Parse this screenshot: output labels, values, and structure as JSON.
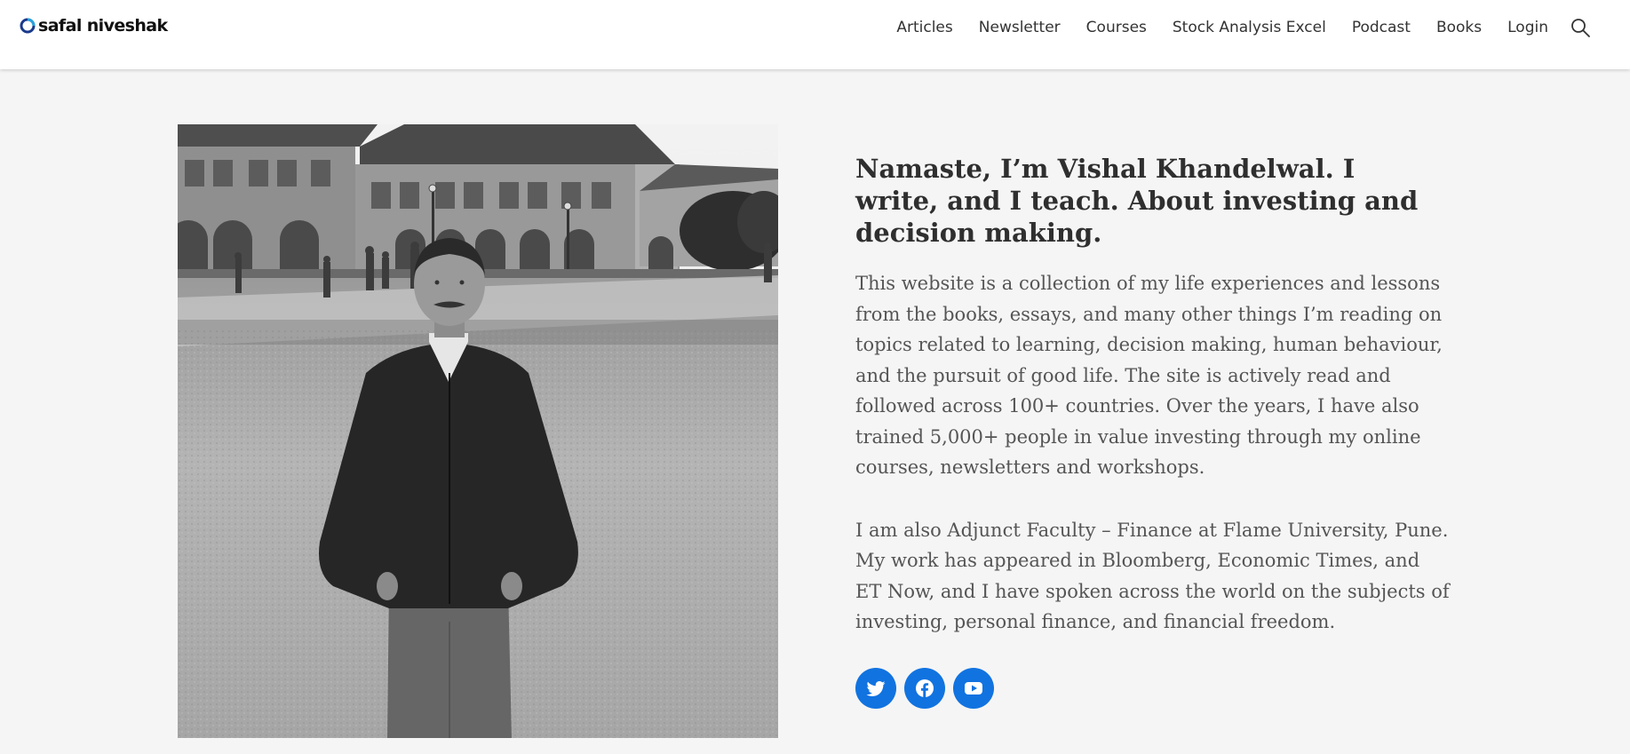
{
  "header": {
    "logo_text": "safal niveshak",
    "nav": [
      "Articles",
      "Newsletter",
      "Courses",
      "Stock Analysis Excel",
      "Podcast",
      "Books",
      "Login"
    ],
    "search_icon": "search-icon"
  },
  "hero": {
    "photo_icon": "portrait-photo",
    "headline": "Namaste, I’m Vishal Khandelwal. I write, and I teach. About investing and decision making.",
    "paragraph1": "This website is a collection of my life experiences and lessons from the books, essays, and many other things I’m reading on topics related to learning, decision making, human behaviour, and the pursuit of good life. The site is actively read and followed across 100+ countries. Over the years, I have also trained 5,000+ people in value investing through my online courses, newsletters and workshops.",
    "paragraph2": "I am also Adjunct Faculty – Finance at Flame University, Pune. My work has appeared in Bloomberg, Economic Times, and ET Now, and I have spoken across the world on the subjects of investing, personal finance, and financial freedom.",
    "socials": [
      "twitter-icon",
      "facebook-icon",
      "youtube-icon"
    ]
  },
  "colors": {
    "accent": "#1173e0",
    "background": "#f5f5f5",
    "header_bg": "#ffffff",
    "headline": "#2f2f2f",
    "body_text": "#555555"
  }
}
